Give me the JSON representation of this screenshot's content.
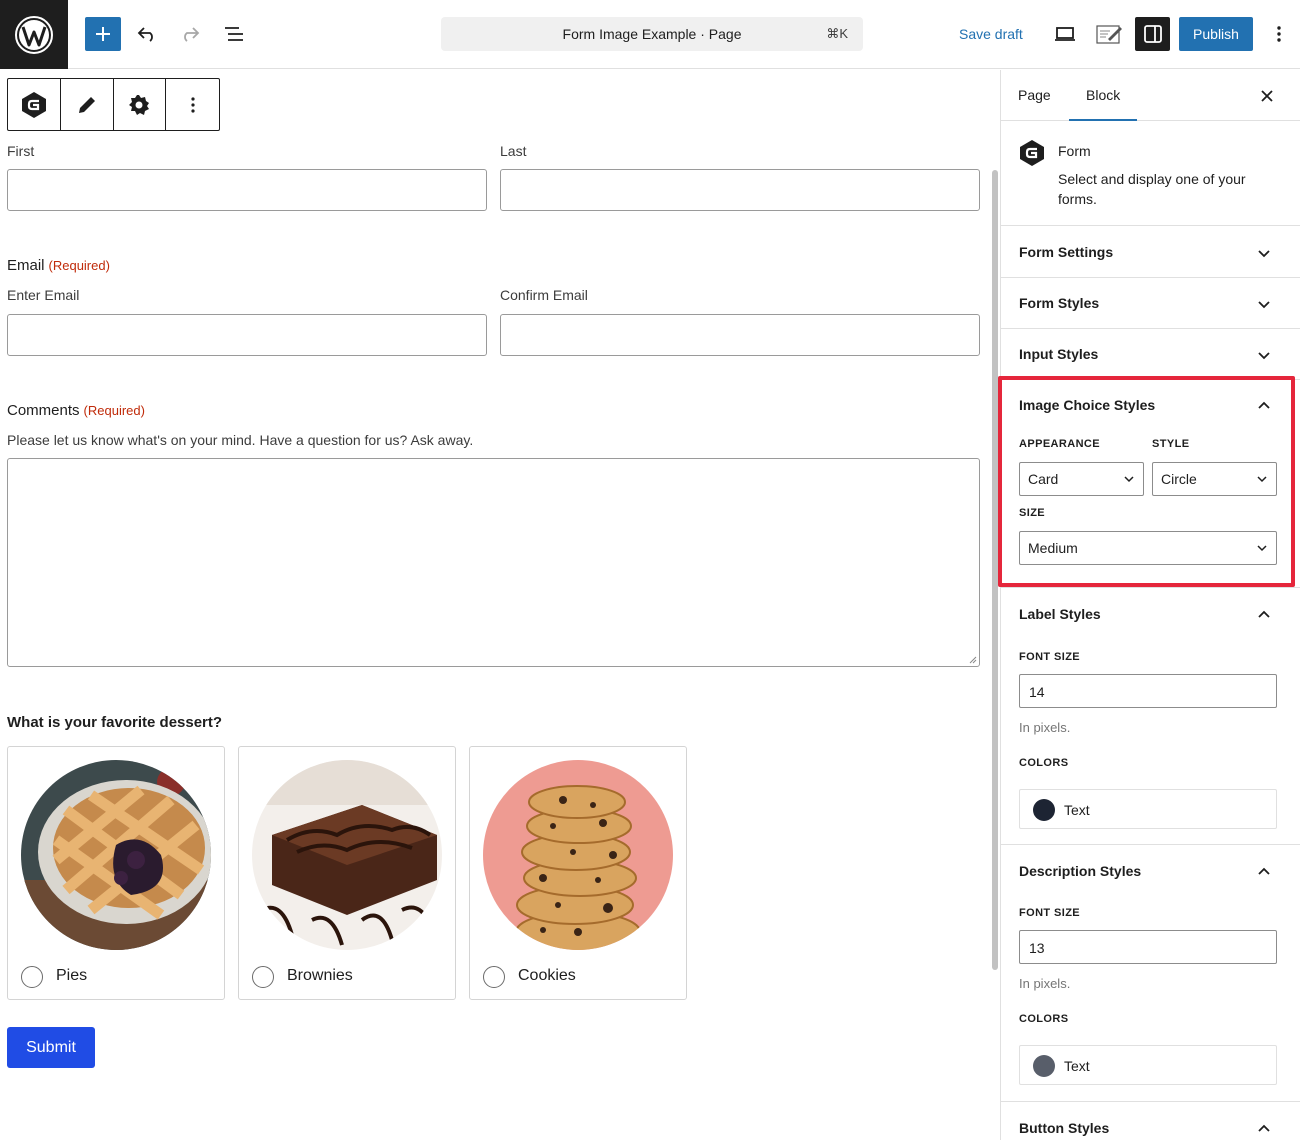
{
  "toolbar": {
    "document_title": "Form Image Example · Page",
    "shortcut": "⌘K",
    "save_draft_label": "Save draft",
    "publish_label": "Publish"
  },
  "form": {
    "name": {
      "first_label": "First",
      "last_label": "Last"
    },
    "email": {
      "heading": "Email",
      "required": "(Required)",
      "enter_label": "Enter Email",
      "confirm_label": "Confirm Email"
    },
    "comments": {
      "heading": "Comments",
      "required": "(Required)",
      "description": "Please let us know what's on your mind. Have a question for us? Ask away."
    },
    "dessert": {
      "question": "What is your favorite dessert?",
      "choices": [
        {
          "label": "Pies",
          "image": "pie-photo"
        },
        {
          "label": "Brownies",
          "image": "brownie-photo"
        },
        {
          "label": "Cookies",
          "image": "cookies-photo"
        }
      ]
    },
    "submit_label": "Submit"
  },
  "sidebar": {
    "tabs": [
      {
        "label": "Page",
        "active": false
      },
      {
        "label": "Block",
        "active": true
      }
    ],
    "block": {
      "title": "Form",
      "description": "Select and display one of your forms."
    },
    "panels": {
      "form_settings": "Form Settings",
      "form_styles": "Form Styles",
      "input_styles": "Input Styles",
      "image_choice": {
        "title": "Image Choice Styles",
        "appearance_label": "APPEARANCE",
        "appearance_value": "Card",
        "style_label": "STYLE",
        "style_value": "Circle",
        "size_label": "SIZE",
        "size_value": "Medium"
      },
      "label_styles": {
        "title": "Label Styles",
        "font_size_label": "FONT SIZE",
        "font_size_value": "14",
        "hint": "In pixels.",
        "colors_label": "COLORS",
        "color_name": "Text",
        "color": "#1d2433"
      },
      "description_styles": {
        "title": "Description Styles",
        "font_size_label": "FONT SIZE",
        "font_size_value": "13",
        "hint": "In pixels.",
        "colors_label": "COLORS",
        "color_name": "Text",
        "color": "#585e6a"
      },
      "button_styles": "Button Styles"
    }
  },
  "colors": {
    "accent": "#2271b1",
    "submit": "#204ce5",
    "required": "#c02b0a",
    "highlight": "#e5263b"
  }
}
